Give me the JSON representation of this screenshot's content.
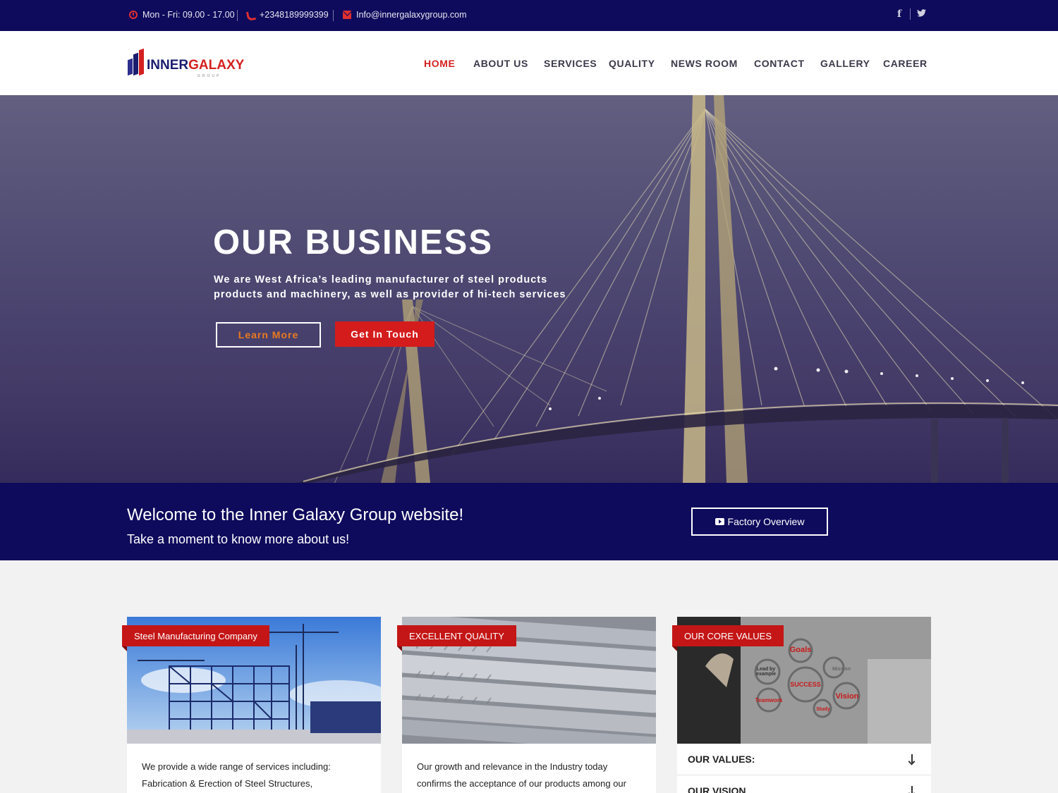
{
  "topbar": {
    "hours": "Mon - Fri: 09.00 - 17.00",
    "phone": "+2348189999399",
    "email": "Info@innergalaxygroup.com"
  },
  "brand": {
    "name_part1": "INNER",
    "name_part2": "GALAXY",
    "tagline": "GROUP",
    "colors": {
      "navy": "#0e0a5c",
      "red": "#d41c1c"
    }
  },
  "nav": {
    "items": [
      {
        "label": "HOME",
        "active": true
      },
      {
        "label": "ABOUT US"
      },
      {
        "label": "SERVICES"
      },
      {
        "label": "QUALITY"
      },
      {
        "label": "NEWS ROOM"
      },
      {
        "label": "CONTACT"
      },
      {
        "label": "GALLERY"
      },
      {
        "label": "CAREER"
      }
    ]
  },
  "hero": {
    "title": "OUR BUSINESS",
    "line1": "We are West Africa’s leading manufacturer of steel products",
    "line2": "products and machinery, as well as provider of hi-tech services",
    "learn_more": "Learn More",
    "get_in_touch": "Get In Touch"
  },
  "welcome": {
    "title": "Welcome to the Inner Galaxy Group website!",
    "subtitle": "Take a moment to know more about us!",
    "factory_button": "Factory Overview"
  },
  "cards": [
    {
      "tag": "Steel Manufacturing Company",
      "line1": "We provide a wide range of services including:",
      "line2": "Fabrication & Erection of Steel Structures,"
    },
    {
      "tag": "EXCELLENT QUALITY",
      "line1": "Our growth and relevance in the Industry today",
      "line2": "confirms the acceptance of our products among our"
    },
    {
      "tag": "OUR CORE VALUES",
      "accordion": [
        "OUR VALUES:",
        "OUR VISION"
      ],
      "gear_labels": [
        "Goals",
        "Lead by example",
        "Mission",
        "SUCCESS",
        "Vision",
        "Teamwork",
        "Study"
      ]
    }
  ]
}
